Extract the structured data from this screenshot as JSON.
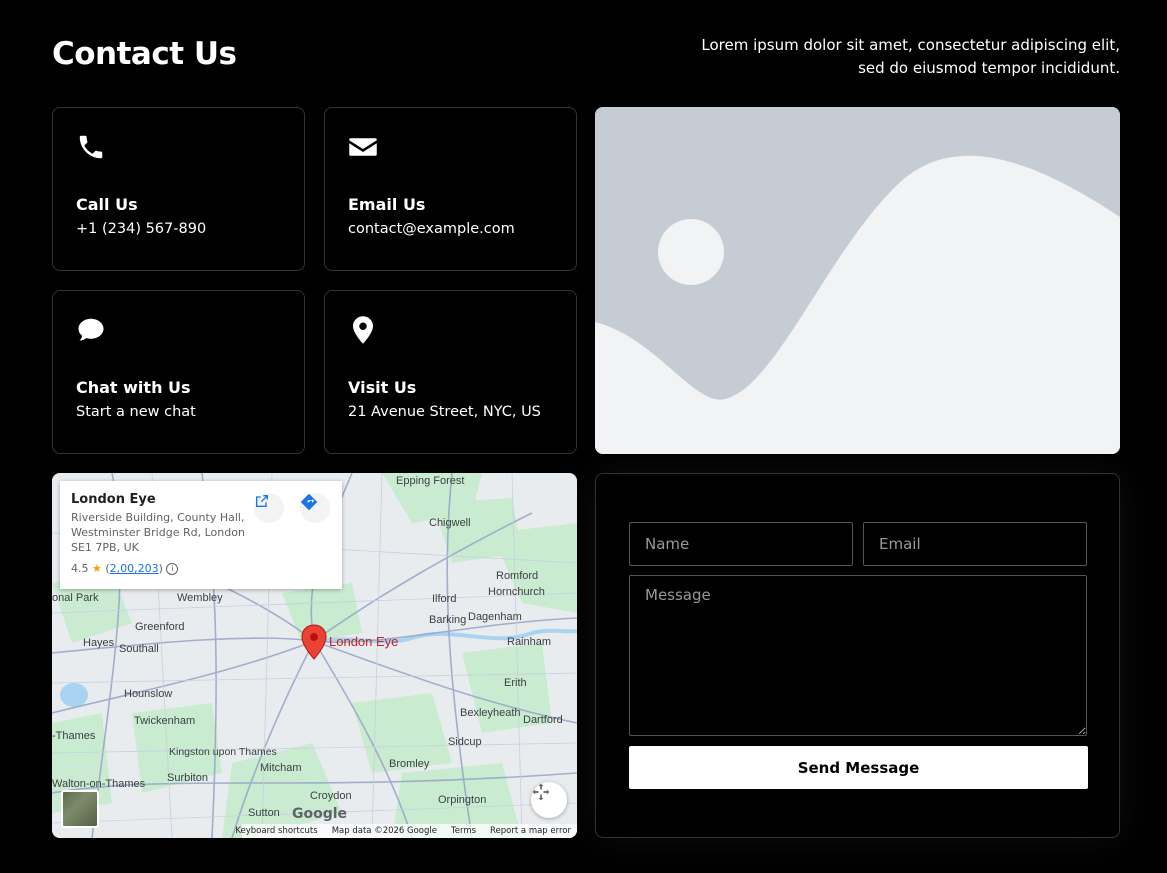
{
  "header": {
    "title": "Contact Us",
    "intro": "Lorem ipsum dolor sit amet, consectetur adipiscing elit, sed do eiusmod tempor incididunt."
  },
  "cards": [
    {
      "icon": "phone-icon",
      "title": "Call Us",
      "subtitle": "+1 (234) 567-890"
    },
    {
      "icon": "envelope-icon",
      "title": "Email Us",
      "subtitle": "contact@example.com"
    },
    {
      "icon": "chat-icon",
      "title": "Chat with Us",
      "subtitle": "Start a new chat"
    },
    {
      "icon": "location-pin-icon",
      "title": "Visit Us",
      "subtitle": "21 Avenue Street, NYC, US"
    }
  ],
  "map": {
    "place_name": "London Eye",
    "address": "Riverside Building, County Hall, Westminster Bridge Rd, London SE1 7PB, UK",
    "rating": "4.5",
    "reviews": "2,00,203",
    "marker_label": "London Eye",
    "labels": [
      "Epping Forest",
      "Chigwell",
      "Romford",
      "Hornchurch",
      "Ilford",
      "Barking",
      "Dagenham",
      "Rainham",
      "Wembley",
      "Greenford",
      "Hayes",
      "Southall",
      "Hounslow",
      "Twickenham",
      "Kingston upon Thames",
      "Surbiton",
      "Mitcham",
      "Bromley",
      "Bexleyheath",
      "Dartford",
      "Sidcup",
      "Erith",
      "Orpington",
      "Croydon",
      "Sutton",
      "Walton-on-Thames",
      "-Thames",
      "onal Park"
    ],
    "footer": [
      "Keyboard shortcuts",
      "Map data ©2026 Google",
      "Terms",
      "Report a map error"
    ],
    "logo": "Google"
  },
  "form": {
    "name_placeholder": "Name",
    "email_placeholder": "Email",
    "message_placeholder": "Message",
    "submit_label": "Send Message"
  }
}
